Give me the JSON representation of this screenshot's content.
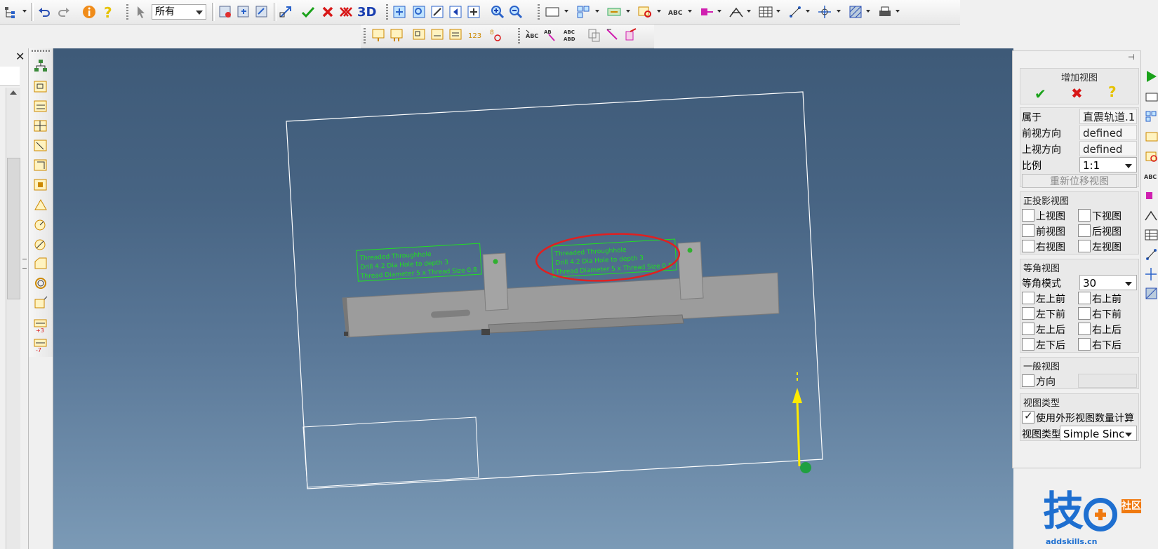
{
  "toolbar": {
    "filter_value": "所有",
    "btn_3d_label": "3D"
  },
  "drawing": {
    "callout_left": {
      "line1": "Threaded Throughhole",
      "line2": "Drill 4.2 Dia Hole to depth 3",
      "line3": "Thread Diameter 5 x Thread Size 0.8"
    },
    "callout_right": {
      "line1": "Threaded Throughhole",
      "line2": "Drill 4.2 Dia Hole to depth 3",
      "line3": "Thread Diameter 5 x Thread Size 0.8"
    },
    "highlight_color": "#e02020",
    "annotation_color": "#20e020"
  },
  "panel": {
    "title": "增加视图",
    "belongs_label": "属于",
    "belongs_value": "直震轨道.1",
    "front_dir_label": "前视方向",
    "front_dir_value": "defined",
    "top_dir_label": "上视方向",
    "top_dir_value": "defined",
    "scale_label": "比例",
    "scale_value": "1:1",
    "relocate_button": "重新位移视图",
    "ortho": {
      "title": "正投影视图",
      "items": [
        "上视图",
        "下视图",
        "前视图",
        "后视图",
        "右视图",
        "左视图"
      ]
    },
    "iso": {
      "title": "等角视图",
      "mode_label": "等角模式",
      "mode_value": "30",
      "items": [
        "左上前",
        "右上前",
        "左下前",
        "右下前",
        "左上后",
        "右上后",
        "左下后",
        "右下后"
      ]
    },
    "general": {
      "title": "一般视图",
      "dir_label": "方向"
    },
    "viewtype": {
      "title": "视图类型",
      "checkbox_label": "使用外形视图数量计算",
      "type_label": "视图类型",
      "type_value": "Simple Sinc"
    }
  },
  "watermark": {
    "char": "技",
    "badge": "社区",
    "url": "addskills.cn"
  }
}
